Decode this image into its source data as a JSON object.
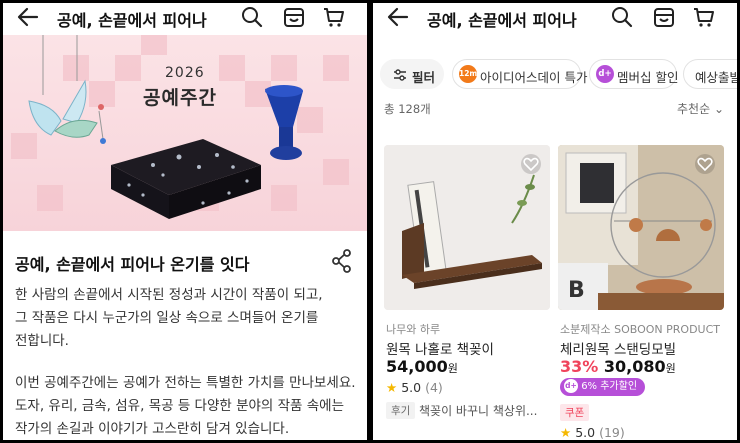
{
  "left": {
    "header_title": "공예, 손끝에서 피어나",
    "banner": {
      "year": "2026",
      "title": "공예주간"
    },
    "headline": "공예, 손끝에서 피어나 온기를 잇다",
    "paragraphs": [
      "한 사람의 손끝에서 시작된 정성과 시간이 작품이 되고,",
      "그 작품은 다시 누군가의 일상 속으로 스며들어 온기를",
      "전합니다.",
      "이번 공예주간에는 공예가 전하는 특별한 가치를 만나보세요.",
      "도자, 유리, 금속, 섬유, 목공 등 다양한 분야의 작품 속에는",
      "작가의 손길과 이야기가 고스란히 담겨 있습니다."
    ]
  },
  "right": {
    "header_title": "공예, 손끝에서 피어나",
    "chips": [
      {
        "label": "필터"
      },
      {
        "badge": "12m",
        "label": "아이디어스데이 특가"
      },
      {
        "badge": "d+",
        "label": "멤버십 할인"
      },
      {
        "label": "예상출발일"
      }
    ],
    "total": "총 128개",
    "sort": "추천순",
    "products": [
      {
        "brand": "나무와 하루",
        "name": "원목 나홀로 책꽂이",
        "price": "54,000",
        "unit": "원",
        "rating": "5.0",
        "review_count": "(4)",
        "tag": "후기",
        "review": "책꽂이 바꾸니 책상위..."
      },
      {
        "brand": "소분제작소 SOBOON PRODUCT",
        "name": "체리원목 스탠딩모빌",
        "discount": "33%",
        "price": "30,080",
        "unit": "원",
        "extra_badge_icon": "d+",
        "extra_badge": "6% 추가할인",
        "tag": "쿠폰",
        "rating": "5.0",
        "review_count": "(19)"
      }
    ]
  },
  "colors": {
    "accent_pink": "#f0445c",
    "membership_purple": "#b64fd8",
    "banner_pink": "#f9dadf"
  }
}
